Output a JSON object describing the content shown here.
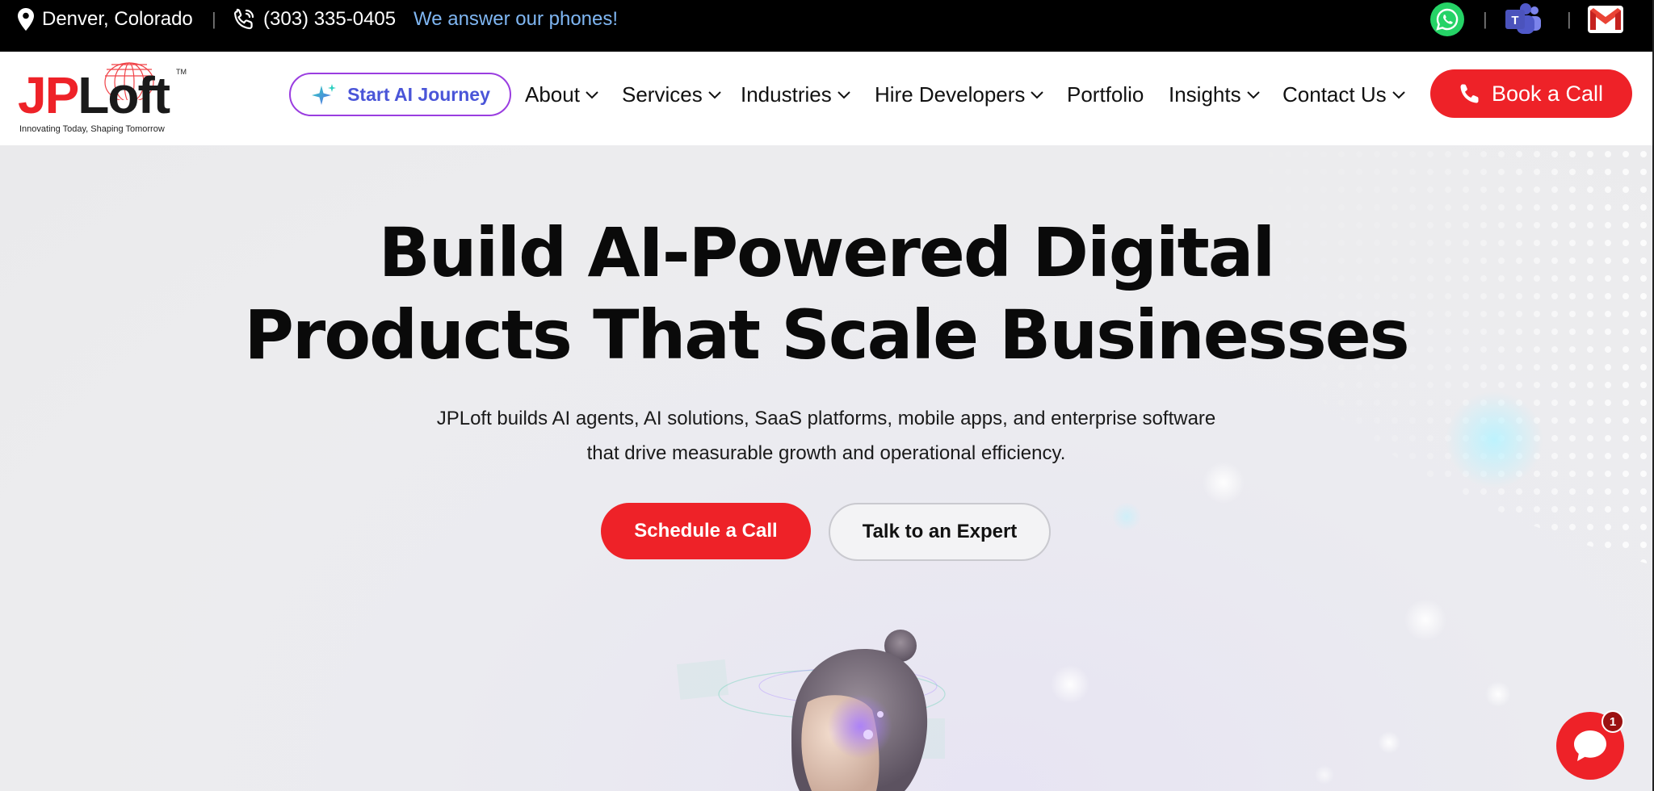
{
  "topbar": {
    "location": "Denver, Colorado",
    "phone": "(303) 335-0405",
    "phone_note": "We answer our phones!",
    "separator": "|",
    "icons": [
      "location-pin-icon",
      "phone-icon",
      "whatsapp-icon",
      "microsoft-teams-icon",
      "gmail-icon"
    ]
  },
  "header": {
    "logo": {
      "jp": "JP",
      "loft": "Loft",
      "tm": "TM",
      "tagline": "Innovating Today, Shaping Tomorrow"
    },
    "ai_button": "Start AI Journey",
    "nav": {
      "about": "About",
      "services": "Services",
      "industries": "Industries",
      "hire": "Hire Developers",
      "portfolio": "Portfolio",
      "insights": "Insights",
      "contact": "Contact Us"
    },
    "book_button": "Book a Call"
  },
  "hero": {
    "title_line1": "Build AI-Powered Digital",
    "title_line2": "Products That Scale Businesses",
    "subtitle_line1": "JPLoft builds AI agents, AI solutions, SaaS platforms, mobile apps, and enterprise software",
    "subtitle_line2": "that drive measurable growth and operational efficiency.",
    "cta_primary": "Schedule a Call",
    "cta_secondary": "Talk to an Expert"
  },
  "chat": {
    "badge_count": "1"
  },
  "colors": {
    "brand_red": "#ee2228",
    "ai_border": "#9a3de0",
    "ai_text": "#4a55d8",
    "phone_note": "#7fb6f2",
    "whatsapp": "#25d366",
    "teams": "#5059c9"
  }
}
